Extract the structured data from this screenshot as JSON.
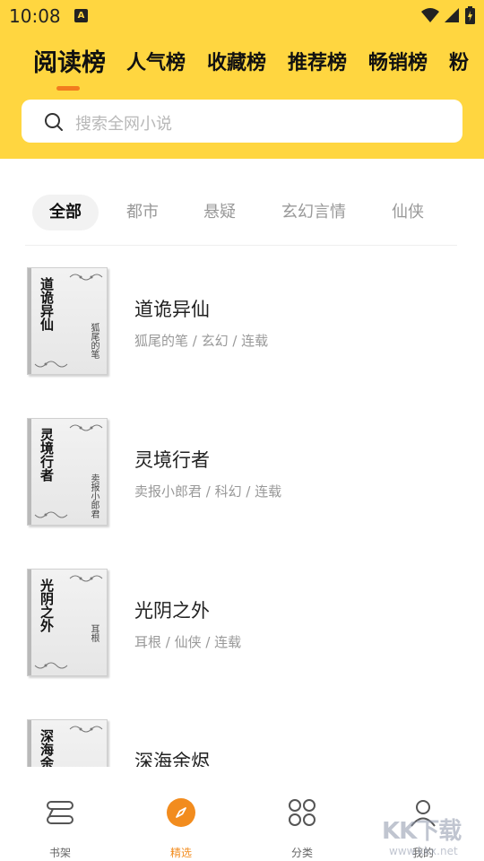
{
  "status_bar": {
    "time": "10:08",
    "notification_badge": "A",
    "icons": [
      "wifi-icon",
      "cell-signal-icon",
      "battery-icon"
    ]
  },
  "rank_tabs": [
    {
      "label": "阅读榜",
      "active": true
    },
    {
      "label": "人气榜",
      "active": false
    },
    {
      "label": "收藏榜",
      "active": false
    },
    {
      "label": "推荐榜",
      "active": false
    },
    {
      "label": "畅销榜",
      "active": false
    },
    {
      "label": "粉",
      "active": false
    }
  ],
  "search": {
    "placeholder": "搜索全网小说",
    "icon": "search-icon"
  },
  "genres": [
    {
      "label": "全部",
      "active": true
    },
    {
      "label": "都市",
      "active": false
    },
    {
      "label": "悬疑",
      "active": false
    },
    {
      "label": "玄幻言情",
      "active": false
    },
    {
      "label": "仙侠",
      "active": false
    }
  ],
  "books": [
    {
      "title": "道诡异仙",
      "cover_title": "道诡异仙",
      "cover_author": "狐尾的笔",
      "meta": "狐尾的笔 / 玄幻 / 连载"
    },
    {
      "title": "灵境行者",
      "cover_title": "灵境行者",
      "cover_author": "卖报小郎君",
      "meta": "卖报小郎君 / 科幻 / 连载"
    },
    {
      "title": "光阴之外",
      "cover_title": "光阴之外",
      "cover_author": "耳根",
      "meta": "耳根 / 仙侠 / 连载"
    },
    {
      "title": "深海余烬",
      "cover_title": "深海余烬",
      "cover_author": "",
      "meta": ""
    }
  ],
  "bottom_nav": [
    {
      "label": "书架",
      "icon": "bookshelf-icon",
      "active": false
    },
    {
      "label": "精选",
      "icon": "compass-icon",
      "active": true
    },
    {
      "label": "分类",
      "icon": "category-grid-icon",
      "active": false
    },
    {
      "label": "我的",
      "icon": "user-icon",
      "active": false
    }
  ],
  "watermark": {
    "text": "KK下载",
    "url": "www.kkx.net"
  },
  "colors": {
    "header_bg": "#FFD640",
    "accent_orange": "#F28C1E",
    "tab_indicator": "#F27C1E",
    "chip_active_bg": "#F2F2F2",
    "muted_text": "#999999"
  }
}
